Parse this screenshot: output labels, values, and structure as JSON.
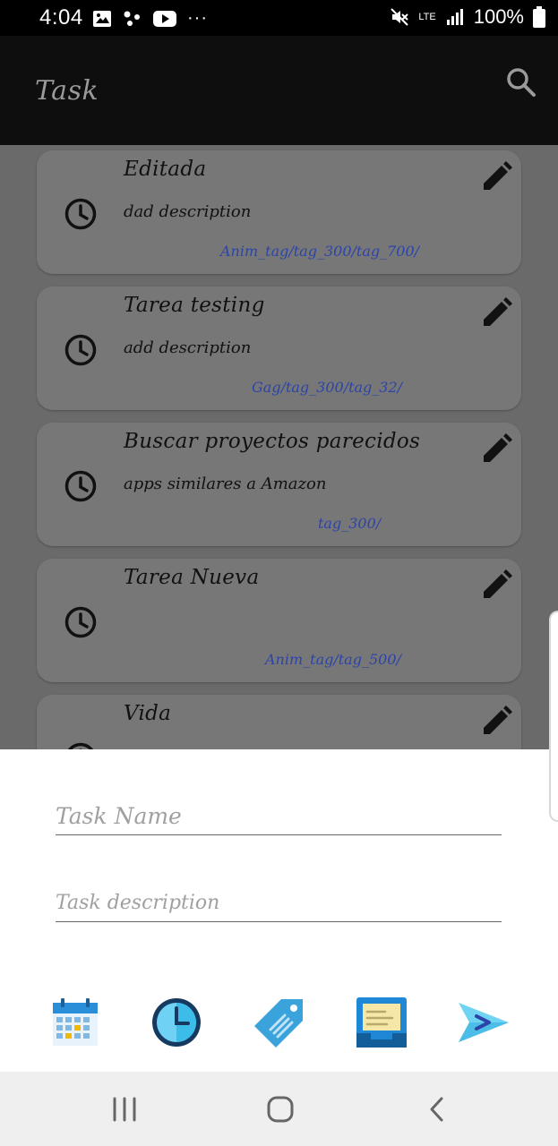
{
  "status_bar": {
    "time": "4:04",
    "dots": "···",
    "network": "LTE",
    "battery": "100%"
  },
  "app_bar": {
    "title": "Task"
  },
  "tasks": [
    {
      "title": "Editada",
      "description": "dad description",
      "tags": "Anim_tag/tag_300/tag_700/"
    },
    {
      "title": "Tarea testing",
      "description": "add description",
      "tags": "Gag/tag_300/tag_32/"
    },
    {
      "title": "Buscar proyectos parecidos",
      "description": "apps similares a Amazon",
      "tags": "tag_300/"
    },
    {
      "title": "Tarea Nueva",
      "description": "",
      "tags": "Anim_tag/tag_500/"
    },
    {
      "title": "Vida",
      "description": "",
      "tags": ""
    }
  ],
  "form": {
    "task_name_placeholder": "Task Name",
    "task_description_placeholder": "Task description"
  },
  "actions": [
    "calendar-icon",
    "clock-icon",
    "tag-icon",
    "inbox-icon",
    "send-icon"
  ],
  "colors": {
    "tag_text": "#2c44a8",
    "calendar_blue": "#2a8fd8",
    "send_blue": "#2c44a8"
  }
}
